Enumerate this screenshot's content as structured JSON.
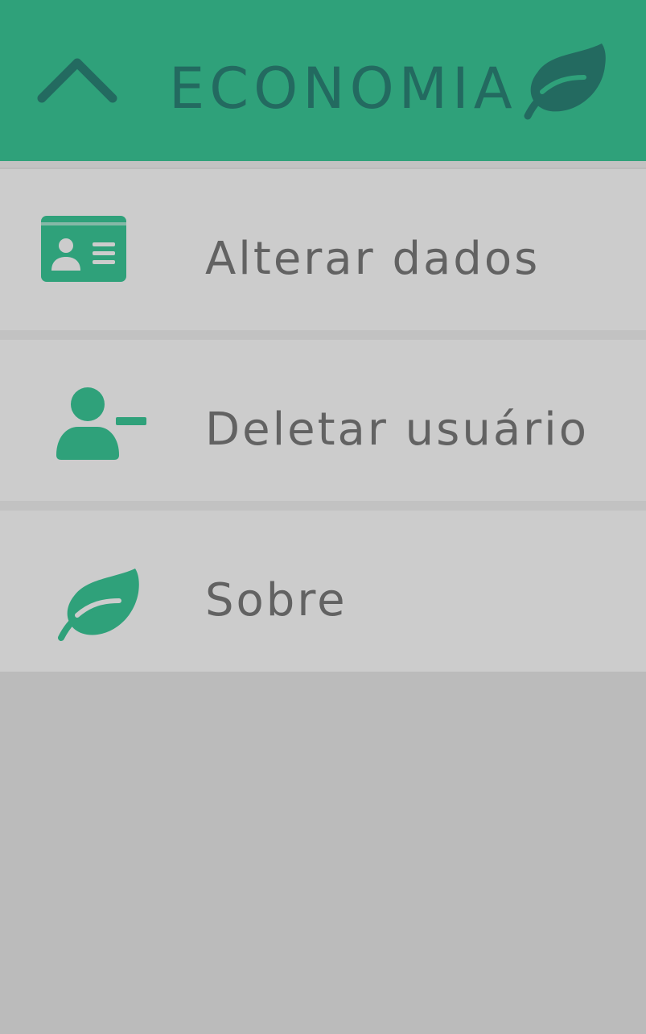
{
  "header": {
    "title": "ECONOMIA",
    "collapse_icon": "chevron-up-icon",
    "brand_icon": "leaf-icon",
    "background_color": "#2fa17a",
    "title_color": "#236a60"
  },
  "menu": {
    "items": [
      {
        "label": "Alterar dados",
        "icon": "id-card-icon"
      },
      {
        "label": "Deletar usuário",
        "icon": "user-minus-icon"
      },
      {
        "label": "Sobre",
        "icon": "leaf-icon"
      }
    ]
  },
  "colors": {
    "accent": "#2fa17a",
    "item_background": "#cccccc",
    "divider": "#c2c2c2",
    "page_background": "#bbbbbb",
    "item_text": "#626262"
  }
}
